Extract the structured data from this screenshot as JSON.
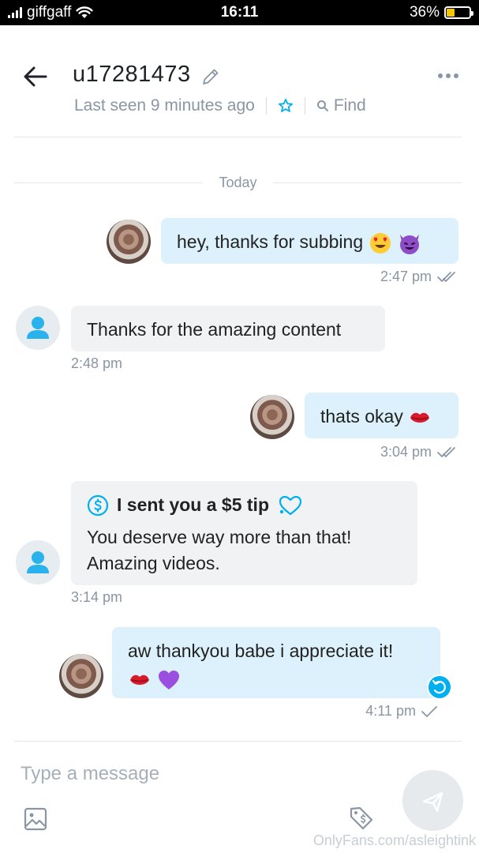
{
  "status_bar": {
    "carrier": "giffgaff",
    "time": "16:11",
    "battery": "36%",
    "battery_level": 0.36
  },
  "header": {
    "username": "u17281473",
    "last_seen": "Last seen 9 minutes ago",
    "find_label": "Find"
  },
  "day_separator": "Today",
  "messages": [
    {
      "direction": "out",
      "text": "hey, thanks for subbing",
      "time": "2:47 pm"
    },
    {
      "direction": "in",
      "text": "Thanks for the amazing content",
      "time": "2:48 pm"
    },
    {
      "direction": "out",
      "text": "thats okay",
      "time": "3:04 pm"
    },
    {
      "direction": "in",
      "tip": "I sent you a $5 tip",
      "text_lines": [
        "You deserve way more than that!",
        "Amazing videos."
      ],
      "time": "3:14 pm"
    },
    {
      "direction": "out",
      "text": "aw thankyou babe i appreciate it!",
      "time": "4:11 pm"
    }
  ],
  "composer": {
    "placeholder": "Type a message"
  },
  "watermark": "OnlyFans.com/asleightink",
  "colors": {
    "accent": "#00aff0",
    "outgoing_bubble": "#dcf1fb",
    "incoming_bubble": "#f0f2f4",
    "muted_text": "#8a96a3"
  },
  "icons": [
    "back-arrow-icon",
    "pencil-icon",
    "more-dots-icon",
    "star-icon",
    "search-icon",
    "double-check-icon",
    "single-check-icon",
    "dollar-icon",
    "undo-icon",
    "image-icon",
    "price-tag-icon",
    "send-icon"
  ]
}
